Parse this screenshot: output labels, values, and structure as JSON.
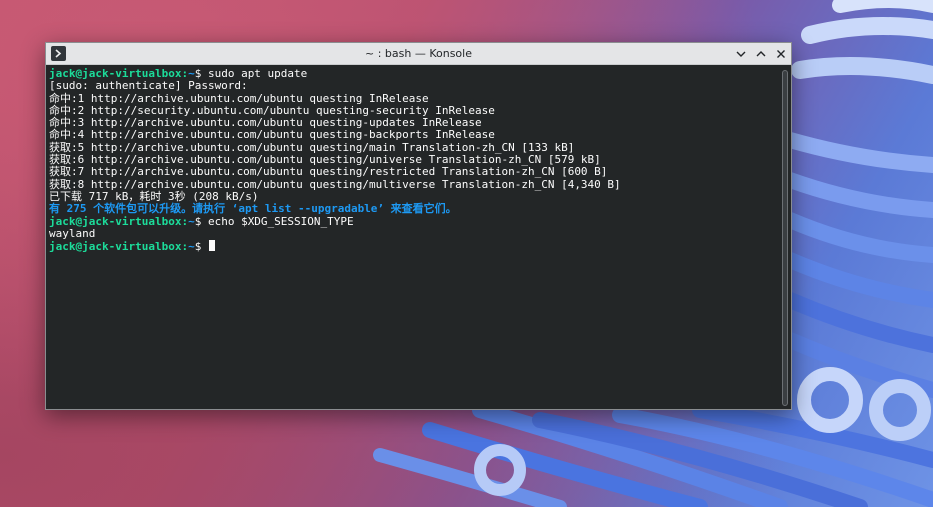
{
  "window": {
    "title": "~ : bash — Konsole"
  },
  "icons": {
    "app": "konsole-terminal-icon",
    "minimize": "chevron-down-icon",
    "maximize": "chevron-up-icon",
    "close": "close-icon"
  },
  "colors": {
    "prompt_user": "#1cdc9a",
    "prompt_path": "#1d99f3",
    "terminal_bg": "#232627",
    "terminal_fg": "#fcfcfc"
  },
  "terminal": {
    "prompt_user": "jack@jack-virtualbox",
    "prompt_path": "~",
    "lines": [
      {
        "kind": "prompt",
        "command": "sudo apt update"
      },
      {
        "kind": "output",
        "text": "[sudo: authenticate] Password:"
      },
      {
        "kind": "output",
        "text": "命中:1 http://archive.ubuntu.com/ubuntu questing InRelease"
      },
      {
        "kind": "output",
        "text": "命中:2 http://security.ubuntu.com/ubuntu questing-security InRelease"
      },
      {
        "kind": "output",
        "text": "命中:3 http://archive.ubuntu.com/ubuntu questing-updates InRelease"
      },
      {
        "kind": "output",
        "text": "命中:4 http://archive.ubuntu.com/ubuntu questing-backports InRelease"
      },
      {
        "kind": "output",
        "text": "获取:5 http://archive.ubuntu.com/ubuntu questing/main Translation-zh_CN [133 kB]"
      },
      {
        "kind": "output",
        "text": "获取:6 http://archive.ubuntu.com/ubuntu questing/universe Translation-zh_CN [579 kB]"
      },
      {
        "kind": "output",
        "text": "获取:7 http://archive.ubuntu.com/ubuntu questing/restricted Translation-zh_CN [600 B]"
      },
      {
        "kind": "output",
        "text": "获取:8 http://archive.ubuntu.com/ubuntu questing/multiverse Translation-zh_CN [4,340 B]"
      },
      {
        "kind": "output",
        "text": "已下载 717 kB，耗时 3秒 (208 kB/s)"
      },
      {
        "kind": "notice",
        "text": "有 275 个软件包可以升级。请执行 ‘apt list --upgradable’ 来查看它们。"
      },
      {
        "kind": "prompt",
        "command": "echo $XDG_SESSION_TYPE"
      },
      {
        "kind": "output",
        "text": "wayland"
      },
      {
        "kind": "prompt",
        "command": ""
      }
    ]
  }
}
